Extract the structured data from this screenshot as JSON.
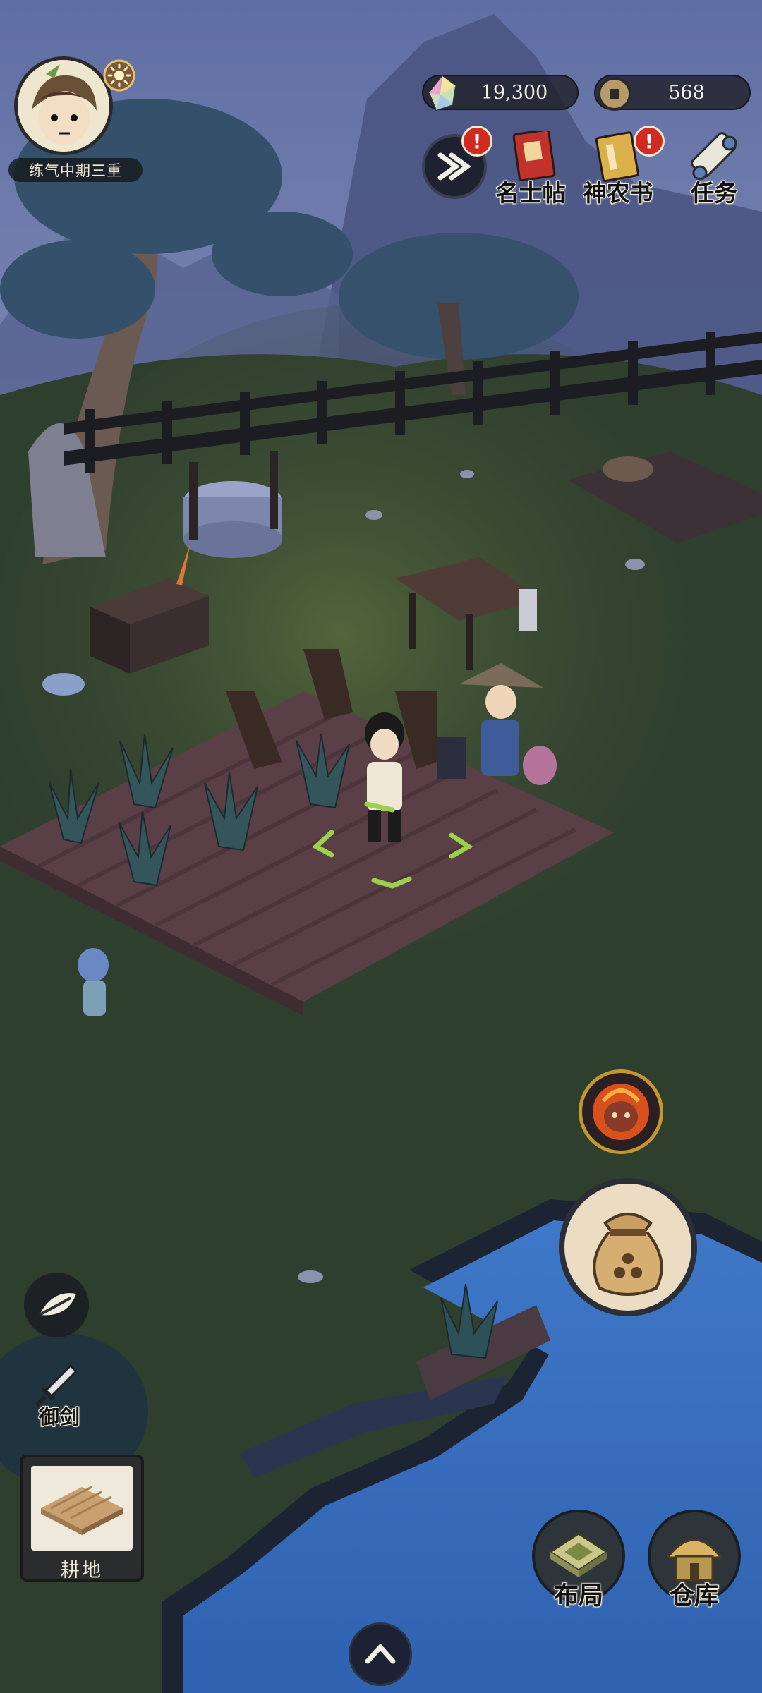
{
  "player": {
    "realm_label": "练气中期三重"
  },
  "currency": {
    "spirit_stone": "19,300",
    "copper_coin": "568"
  },
  "top_menu": {
    "scholar_card": "名士帖",
    "shennong_book": "神农书",
    "tasks": "任务",
    "alert_mark": "!"
  },
  "left_tools": {
    "sword_flight": "御剑",
    "farmland": "耕地"
  },
  "bottom_menu": {
    "layout": "布局",
    "warehouse": "仓库"
  },
  "icons": {
    "collapse": "double-chevron-right-icon",
    "fire_deity": "fire-spirit-icon",
    "seed_bag": "seed-bag-icon",
    "up": "chevron-up-icon",
    "leaf": "leaf-icon",
    "sword": "sword-icon"
  },
  "colors": {
    "grass": "#2f3f2e",
    "soil": "#5a3f47",
    "water": "#3c74c4",
    "sky": "#6a7ab0",
    "alert": "#d12a20",
    "selection": "#9ccf4a"
  }
}
